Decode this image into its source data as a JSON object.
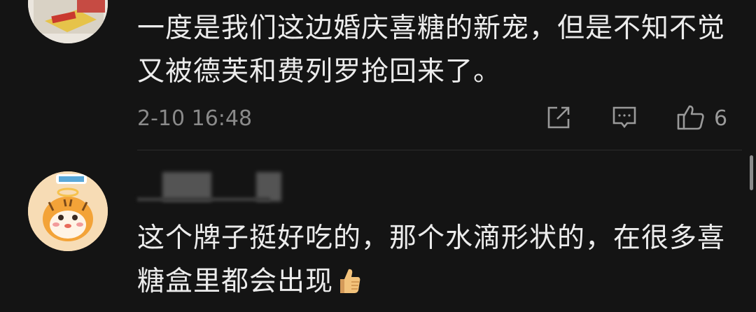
{
  "comments": [
    {
      "text": "一度是我们这边婚庆喜糖的新宠，但是不知不觉又被德芙和费列罗抢回来了。",
      "timestamp": "2-10 16:48",
      "like_count": "6",
      "icons": {
        "share": "share-icon",
        "reply": "comment-icon",
        "like": "thumbs-up-icon"
      }
    },
    {
      "text": "这个牌子挺好吃的，那个水滴形状的，在很多喜糖盒里都会出现",
      "emoji": "thumbs-up-emoji"
    }
  ],
  "colors": {
    "background": "#141414",
    "text": "#ececec",
    "meta": "#8a8a8a",
    "icon": "#9a9a9a"
  }
}
